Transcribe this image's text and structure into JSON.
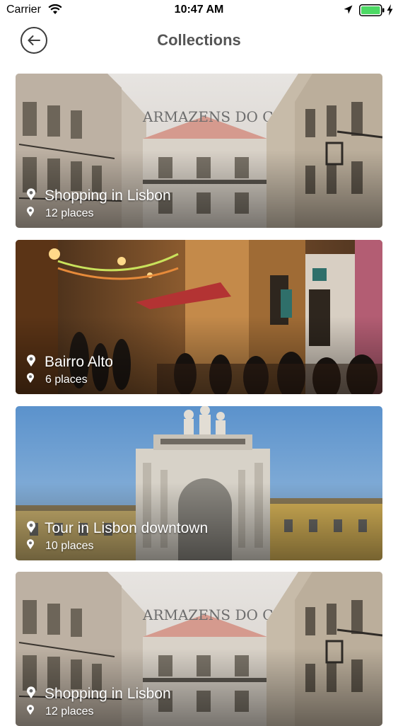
{
  "status_bar": {
    "carrier": "Carrier",
    "time": "10:47 AM",
    "icons": [
      "wifi-icon",
      "location-icon",
      "battery-icon",
      "charging-icon"
    ],
    "battery_color": "#4cd964"
  },
  "header": {
    "back_icon": "arrow-left-icon",
    "title": "Collections"
  },
  "collections": [
    {
      "title": "Shopping in Lisbon",
      "count": "12 places",
      "icon": "location-pin-icon",
      "photo": "street-with-armazens-do-chiado-building"
    },
    {
      "title": "Bairro Alto",
      "count": "6 places",
      "icon": "location-pin-icon",
      "photo": "night-street-with-outdoor-dining"
    },
    {
      "title": "Tour in Lisbon downtown",
      "count": "10 places",
      "icon": "location-pin-icon",
      "photo": "triumphal-arch-under-blue-sky"
    },
    {
      "title": "Shopping in Lisbon",
      "count": "12 places",
      "icon": "location-pin-icon",
      "photo": "street-with-armazens-do-chiado-building"
    }
  ],
  "colors": {
    "title_text": "#555555",
    "card_text": "#ffffff"
  }
}
